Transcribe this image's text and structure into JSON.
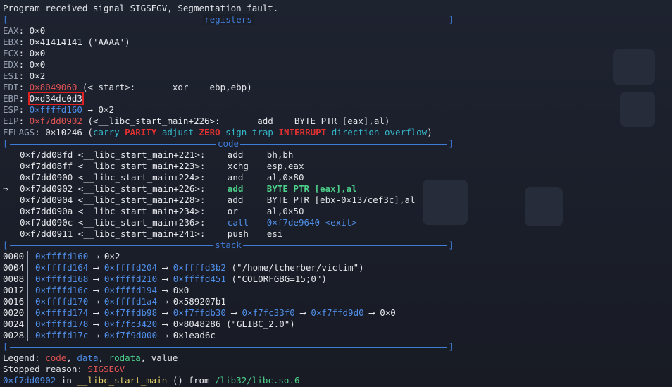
{
  "header": "Program received signal SIGSEGV, Segmentation fault.",
  "sections": {
    "registers": "registers",
    "code": "code",
    "stack": "stack"
  },
  "registers": [
    {
      "name": "EAX",
      "value": "0×0",
      "value_color": "plain"
    },
    {
      "name": "EBX",
      "value": "0×41414141",
      "extra": "('AAAA')",
      "value_color": "plain"
    },
    {
      "name": "ECX",
      "value": "0×0",
      "value_color": "plain"
    },
    {
      "name": "EDX",
      "value": "0×0",
      "value_color": "plain"
    },
    {
      "name": "ESI",
      "value": "0×2",
      "value_color": "plain"
    },
    {
      "name": "EDI",
      "value": "0×8049060",
      "extra": "(<_start>:       xor    ebp,ebp)",
      "value_color": "red"
    },
    {
      "name": "EBP",
      "value": "0×d34dc0d3",
      "value_color": "plain",
      "highlighted": true
    },
    {
      "name": "ESP",
      "value": "0×ffffd160",
      "extra": "→ 0×2",
      "value_color": "blue"
    },
    {
      "name": "EIP",
      "value": "0×f7dd0902",
      "extra": "(<__libc_start_main+226>:       add    BYTE PTR [eax],al)",
      "value_color": "red"
    }
  ],
  "eflags": {
    "name": "EFLAGS",
    "value": "0×10246",
    "flags": [
      {
        "t": "carry",
        "on": false
      },
      {
        "t": "PARITY",
        "on": true
      },
      {
        "t": "adjust",
        "on": false
      },
      {
        "t": "ZERO",
        "on": true
      },
      {
        "t": "sign",
        "on": false
      },
      {
        "t": "trap",
        "on": false
      },
      {
        "t": "INTERRUPT",
        "on": true
      },
      {
        "t": "direction",
        "on": false
      },
      {
        "t": "overflow",
        "on": false
      }
    ]
  },
  "code": [
    {
      "marker": "",
      "addr": "0×f7dd08fd",
      "sym": "<__libc_start_main+221>:",
      "op": "add",
      "args": "bh,bh"
    },
    {
      "marker": "",
      "addr": "0×f7dd08ff",
      "sym": "<__libc_start_main+223>:",
      "op": "xchg",
      "args": "esp,eax"
    },
    {
      "marker": "",
      "addr": "0×f7dd0900",
      "sym": "<__libc_start_main+224>:",
      "op": "and",
      "args": "al,0×80"
    },
    {
      "marker": "⇒",
      "addr": "0×f7dd0902",
      "sym": "<__libc_start_main+226>:",
      "op": "add",
      "args": "BYTE PTR [eax],al",
      "current": true
    },
    {
      "marker": "",
      "addr": "0×f7dd0904",
      "sym": "<__libc_start_main+228>:",
      "op": "add",
      "args": "BYTE PTR [ebx-0×137cef3c],al"
    },
    {
      "marker": "",
      "addr": "0×f7dd090a",
      "sym": "<__libc_start_main+234>:",
      "op": "or",
      "args": "al,0×50"
    },
    {
      "marker": "",
      "addr": "0×f7dd090c",
      "sym": "<__libc_start_main+236>:",
      "op": "call",
      "args": "0×f7de9640 <exit>",
      "call": true
    },
    {
      "marker": "",
      "addr": "0×f7dd0911",
      "sym": "<__libc_start_main+241>:",
      "op": "push",
      "args": "esi"
    }
  ],
  "stack": [
    {
      "off": "0000",
      "chain": [
        {
          "v": "0×ffffd160",
          "c": "blue"
        },
        {
          "v": "0×2",
          "c": "plain"
        }
      ]
    },
    {
      "off": "0004",
      "chain": [
        {
          "v": "0×ffffd164",
          "c": "blue"
        },
        {
          "v": "0×ffffd204",
          "c": "blue"
        },
        {
          "v": "0×ffffd3b2",
          "c": "blue"
        },
        {
          "v": "(\"/home/tcherber/victim\")",
          "c": "plain",
          "noarrow": true
        }
      ]
    },
    {
      "off": "0008",
      "chain": [
        {
          "v": "0×ffffd168",
          "c": "blue"
        },
        {
          "v": "0×ffffd210",
          "c": "blue"
        },
        {
          "v": "0×ffffd451",
          "c": "blue"
        },
        {
          "v": "(\"COLORFGBG=15;0\")",
          "c": "plain",
          "noarrow": true
        }
      ]
    },
    {
      "off": "0012",
      "chain": [
        {
          "v": "0×ffffd16c",
          "c": "blue"
        },
        {
          "v": "0×ffffd194",
          "c": "blue"
        },
        {
          "v": "0×0",
          "c": "plain"
        }
      ]
    },
    {
      "off": "0016",
      "chain": [
        {
          "v": "0×ffffd170",
          "c": "blue"
        },
        {
          "v": "0×ffffd1a4",
          "c": "blue"
        },
        {
          "v": "0×589207b1",
          "c": "plain"
        }
      ]
    },
    {
      "off": "0020",
      "chain": [
        {
          "v": "0×ffffd174",
          "c": "blue"
        },
        {
          "v": "0×f7ffdb98",
          "c": "blue"
        },
        {
          "v": "0×f7ffdb30",
          "c": "blue"
        },
        {
          "v": "0×f7fc33f0",
          "c": "blue"
        },
        {
          "v": "0×f7ffd9d0",
          "c": "blue"
        },
        {
          "v": "0×0",
          "c": "plain"
        }
      ]
    },
    {
      "off": "0024",
      "chain": [
        {
          "v": "0×ffffd178",
          "c": "blue"
        },
        {
          "v": "0×f7fc3420",
          "c": "blue"
        },
        {
          "v": "0×8048286",
          "c": "plain"
        },
        {
          "v": "(\"GLIBC_2.0\")",
          "c": "plain",
          "noarrow": true
        }
      ]
    },
    {
      "off": "0028",
      "chain": [
        {
          "v": "0×ffffd17c",
          "c": "blue"
        },
        {
          "v": "0×f7f9d000",
          "c": "blue"
        },
        {
          "v": "0×1ead6c",
          "c": "plain"
        }
      ]
    }
  ],
  "legend": {
    "label": "Legend:",
    "code": "code",
    "data": "data",
    "rodata": "rodata",
    "value": "value"
  },
  "stopped": {
    "label": "Stopped reason:",
    "reason": "SIGSEGV"
  },
  "frame": {
    "addr": "0×f7dd0902",
    "in": "in",
    "func": "__libc_start_main",
    "args": "()",
    "from": "from",
    "lib": "/lib32/libc.so.6"
  },
  "colors": {
    "red": "#e05252",
    "blue": "#4f8ee8",
    "green": "#4cd08a",
    "cyan": "#35b6c8",
    "bg": "#1b1f2a"
  }
}
